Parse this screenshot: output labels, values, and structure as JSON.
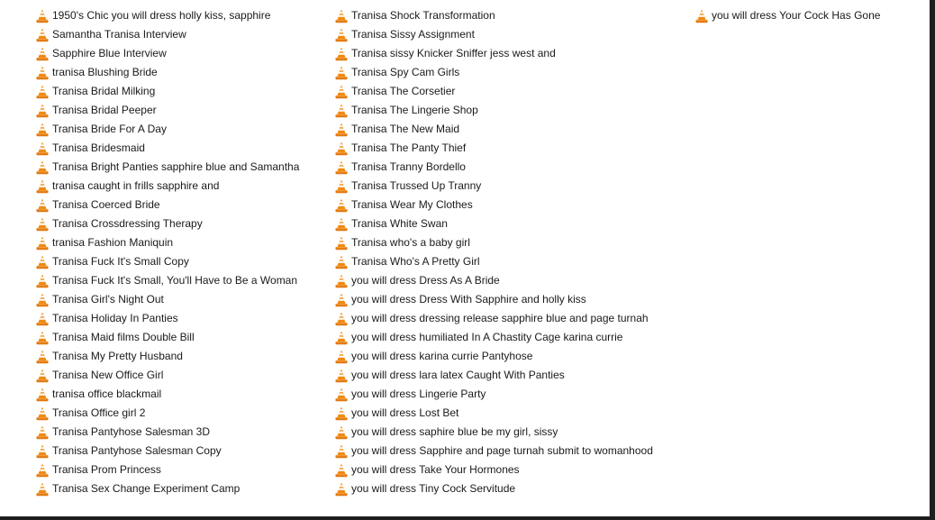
{
  "file_list": {
    "icon": "vlc-cone-icon",
    "columns": [
      {
        "items": [
          "1950's Chic you will dress holly kiss, sapphire",
          "Samantha Tranisa Interview",
          "Sapphire Blue Interview",
          "tranisa Blushing Bride",
          "Tranisa Bridal Milking",
          "Tranisa Bridal Peeper",
          "Tranisa Bride For A Day",
          "Tranisa Bridesmaid",
          "Tranisa Bright Panties sapphire blue and Samantha",
          "tranisa caught in frills sapphire and",
          "Tranisa Coerced Bride",
          "Tranisa Crossdressing Therapy",
          "tranisa Fashion Maniquin",
          "Tranisa Fuck It's Small Copy",
          "Tranisa Fuck It's Small, You'll Have to Be a Woman",
          "Tranisa Girl's Night Out",
          "Tranisa Holiday In Panties",
          "Tranisa Maid films  Double Bill",
          "Tranisa My Pretty Husband",
          "Tranisa New Office Girl",
          "tranisa office blackmail",
          "Tranisa Office girl 2",
          "Tranisa Pantyhose Salesman 3D",
          "Tranisa Pantyhose Salesman Copy",
          "Tranisa Prom Princess",
          "Tranisa Sex Change Experiment Camp"
        ]
      },
      {
        "items": [
          "Tranisa Shock Transformation",
          "Tranisa Sissy Assignment",
          "Tranisa sissy Knicker Sniffer jess west and",
          "Tranisa Spy Cam Girls",
          "Tranisa The Corsetier",
          "Tranisa The Lingerie Shop",
          "Tranisa The New Maid",
          "Tranisa The Panty Thief",
          "Tranisa Tranny Bordello",
          "Tranisa Trussed Up Tranny",
          "Tranisa Wear My Clothes",
          "Tranisa White Swan",
          "Tranisa who's a baby girl",
          "Tranisa Who's A Pretty Girl",
          "you will dress Dress As A Bride",
          "you will dress Dress With Sapphire and holly kiss",
          "you will dress dressing release sapphire blue and page turnah",
          "you will dress humiliated In A Chastity Cage karina currie",
          "you will dress karina currie Pantyhose",
          "you will dress lara latex Caught With Panties",
          "you will dress Lingerie Party",
          "you will dress Lost Bet",
          "you will dress saphire blue be my girl, sissy",
          "you will dress Sapphire and page turnah submit to womanhood",
          "you will dress Take Your Hormones",
          "you will dress Tiny Cock Servitude"
        ]
      },
      {
        "items": [
          "you will dress Your Cock Has Gone"
        ]
      }
    ]
  }
}
